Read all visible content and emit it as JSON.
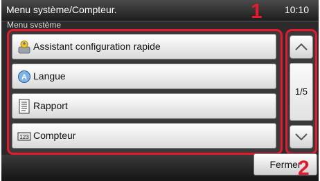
{
  "header": {
    "title": "Menu système/Compteur.",
    "time": "10:10",
    "subtitle": "Menu système"
  },
  "menu": {
    "items": [
      {
        "label": "Assistant configuration rapide",
        "icon": "wizard-icon"
      },
      {
        "label": "Langue",
        "icon": "language-icon"
      },
      {
        "label": "Rapport",
        "icon": "report-icon"
      },
      {
        "label": "Compteur",
        "icon": "counter-icon"
      }
    ]
  },
  "pager": {
    "page": "1/5",
    "up_icon": "chevron-up-icon",
    "down_icon": "chevron-down-icon"
  },
  "footer": {
    "close_label": "Fermer"
  },
  "callouts": {
    "one": "1",
    "two": "2"
  },
  "colors": {
    "callout": "#e8192c",
    "background": "#2b2b2b"
  }
}
